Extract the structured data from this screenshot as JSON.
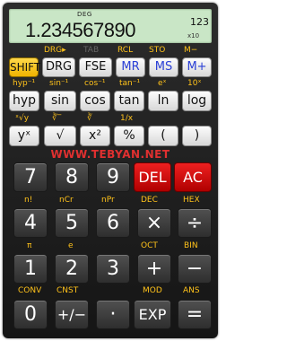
{
  "display": {
    "mode": "DEG",
    "mantissa": "1.234567890",
    "exponent": "123",
    "base": "x10"
  },
  "row1": {
    "top": [
      "DRG▸",
      "TAB",
      "RCL",
      "STO",
      "M−"
    ],
    "keys": [
      "SHIFT",
      "DRG",
      "FSE",
      "MR",
      "MS",
      "M+"
    ]
  },
  "row2": {
    "top": [
      "hyp⁻¹",
      "sin⁻¹",
      "cos⁻¹",
      "tan⁻¹",
      "eˣ",
      "10ˣ"
    ],
    "keys": [
      "hyp",
      "sin",
      "cos",
      "tan",
      "ln",
      "log"
    ]
  },
  "row3": {
    "top": [
      "ˣ√y",
      "∛‾",
      "∛",
      "1/x"
    ],
    "keys": [
      "yˣ",
      "√",
      "x²",
      "%",
      "(",
      ")"
    ]
  },
  "watermark": "WWW.TEBYAN.NET",
  "row4": {
    "top": [],
    "keys": [
      "7",
      "8",
      "9",
      "DEL",
      "AC"
    ]
  },
  "row5": {
    "top": [
      "n!",
      "nCr",
      "nPr",
      "DEC",
      "HEX"
    ],
    "keys": [
      "4",
      "5",
      "6",
      "×",
      "÷"
    ]
  },
  "row6": {
    "top": [
      "π",
      "e",
      "OCT",
      "BIN"
    ],
    "keys": [
      "1",
      "2",
      "3",
      "+",
      "−"
    ]
  },
  "row7": {
    "top": [
      "CONV",
      "CNST",
      "MOD",
      "ANS"
    ],
    "keys": [
      "0",
      "+/−",
      "·",
      "EXP",
      "="
    ]
  },
  "colors": {
    "shift": "#f5c21a",
    "memory": "#2a3fd6",
    "delete": "#d41010",
    "display": "#c9e6c6"
  }
}
